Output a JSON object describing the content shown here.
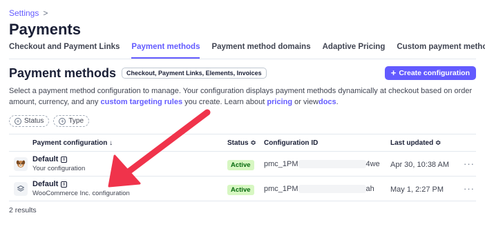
{
  "breadcrumb": {
    "parent": "Settings",
    "separator": ">"
  },
  "page_title": "Payments",
  "tabs": [
    {
      "label": "Checkout and Payment Links",
      "active": false
    },
    {
      "label": "Payment methods",
      "active": true
    },
    {
      "label": "Payment method domains",
      "active": false
    },
    {
      "label": "Adaptive Pricing",
      "active": false
    },
    {
      "label": "Custom payment methods",
      "active": false
    }
  ],
  "section": {
    "title": "Payment methods",
    "badge": "Checkout, Payment Links, Elements, Invoices",
    "create_button": "Create configuration"
  },
  "description": {
    "part1": "Select a payment method configuration to manage. Your configuration displays payment methods dynamically at checkout based on order amount, currency, and any",
    "link1": "custom targeting rules",
    "part2": "you create. Learn about",
    "link2": "pricing",
    "part3": "or view",
    "link3": "docs",
    "part4": "."
  },
  "filters": [
    "Status",
    "Type"
  ],
  "table": {
    "headers": {
      "name": "Payment configuration ↓",
      "status": "Status ≎",
      "id": "Configuration ID",
      "date": "Last updated ≎"
    },
    "rows": [
      {
        "icon": "dog-avatar-icon",
        "name": "Default",
        "sub": "Your configuration",
        "status": "Active",
        "id_prefix": "pmc_1PM",
        "id_suffix": "4we",
        "date": "Apr 30, 10:38 AM",
        "more": "···"
      },
      {
        "icon": "layers-icon",
        "name": "Default",
        "sub": "WooCommerce Inc. configuration",
        "status": "Active",
        "id_prefix": "pmc_1PM",
        "id_suffix": "ah",
        "date": "May 1, 2:27 PM",
        "more": "···"
      }
    ]
  },
  "results": "2 results",
  "colors": {
    "accent": "#635bff",
    "active_badge_bg": "#d7f7c2",
    "active_badge_text": "#05690d",
    "arrow": "#f0334b"
  }
}
